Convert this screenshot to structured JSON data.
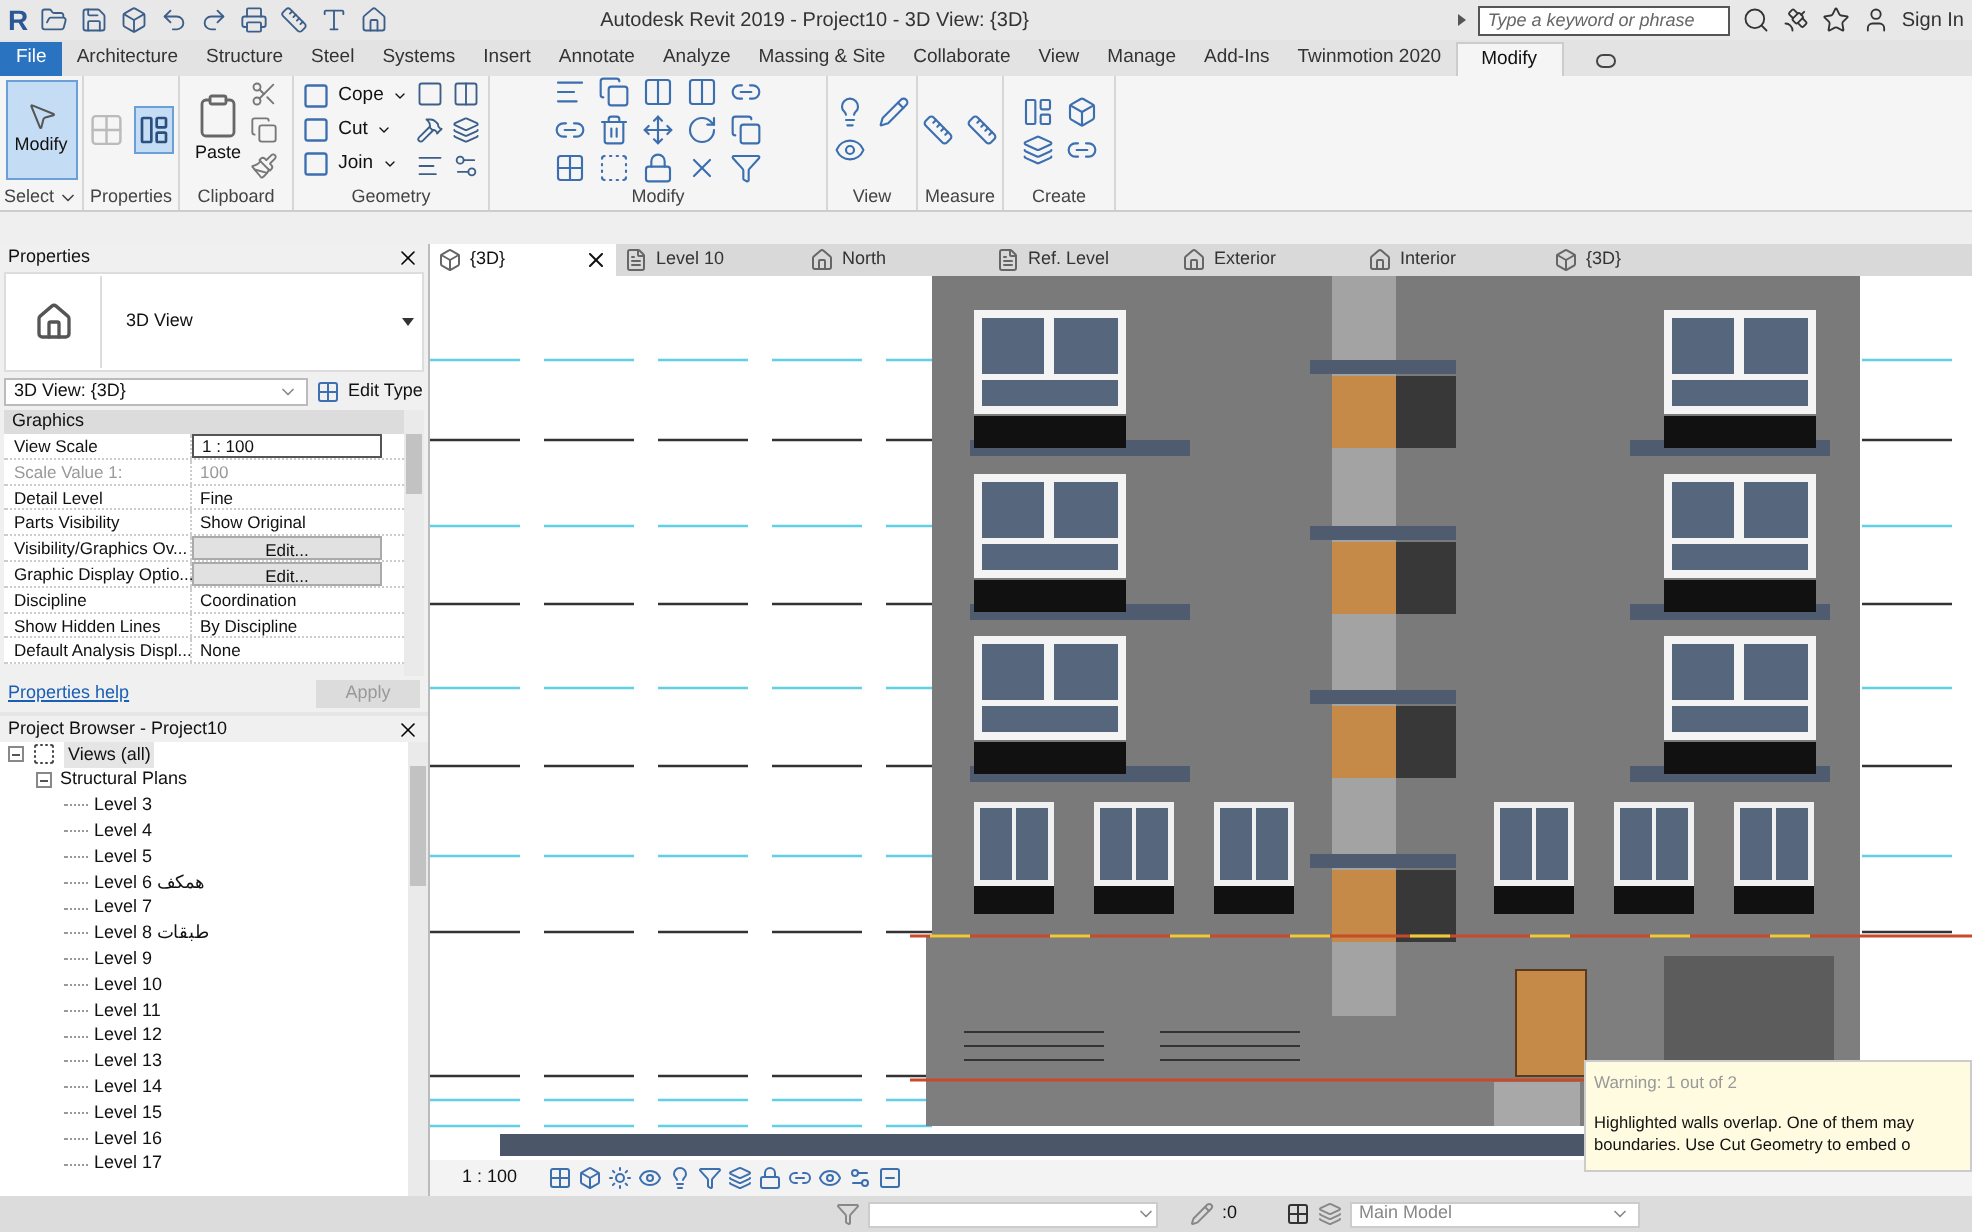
{
  "title_bar": {
    "logo": "R",
    "title": "Autodesk Revit 2019 - Project10 - 3D View: {3D}",
    "search": {
      "placeholder": "Type a keyword or phrase"
    },
    "sign_in": "Sign In"
  },
  "ribbon_tabs": [
    {
      "label": "File",
      "kind": "application",
      "selected": false
    },
    {
      "label": "Architecture",
      "kind": "tab",
      "selected": false
    },
    {
      "label": "Structure",
      "kind": "tab",
      "selected": false
    },
    {
      "label": "Steel",
      "kind": "tab",
      "selected": false
    },
    {
      "label": "Systems",
      "kind": "tab",
      "selected": false
    },
    {
      "label": "Insert",
      "kind": "tab",
      "selected": false
    },
    {
      "label": "Annotate",
      "kind": "tab",
      "selected": false
    },
    {
      "label": "Analyze",
      "kind": "tab",
      "selected": false
    },
    {
      "label": "Massing & Site",
      "kind": "tab",
      "selected": false
    },
    {
      "label": "Collaborate",
      "kind": "tab",
      "selected": false
    },
    {
      "label": "View",
      "kind": "tab",
      "selected": false
    },
    {
      "label": "Manage",
      "kind": "tab",
      "selected": false
    },
    {
      "label": "Add-Ins",
      "kind": "tab",
      "selected": false
    },
    {
      "label": "Twinmotion 2020",
      "kind": "tab",
      "selected": false
    },
    {
      "label": "Modify",
      "kind": "tab",
      "selected": true
    }
  ],
  "ribbon_panels": [
    {
      "label": "Select",
      "tools": [
        {
          "label": "Modify",
          "selected": true
        }
      ]
    },
    {
      "label": "Properties"
    },
    {
      "label": "Clipboard",
      "tools": [
        {
          "label": "Paste",
          "selected": false
        }
      ]
    },
    {
      "label": "Geometry",
      "tools": [
        {
          "label": "Cope",
          "selected": false
        },
        {
          "label": "Cut",
          "selected": false
        },
        {
          "label": "Join",
          "selected": false
        }
      ]
    },
    {
      "label": "Modify"
    },
    {
      "label": "View"
    },
    {
      "label": "Measure"
    },
    {
      "label": "Create"
    }
  ],
  "properties": {
    "title": "Properties",
    "type_name": "3D View",
    "type_selector": "3D View: {3D}",
    "edit_type": "Edit Type",
    "section": "Graphics",
    "rows": [
      {
        "name": "View Scale",
        "value": "1 : 100",
        "kind": "input",
        "disabled": false
      },
      {
        "name": "Scale Value    1:",
        "value": "100",
        "kind": "text",
        "disabled": true
      },
      {
        "name": "Detail Level",
        "value": "Fine",
        "kind": "text",
        "disabled": false
      },
      {
        "name": "Parts Visibility",
        "value": "Show Original",
        "kind": "text",
        "disabled": false
      },
      {
        "name": "Visibility/Graphics Ov...",
        "value": "Edit...",
        "kind": "button",
        "disabled": false
      },
      {
        "name": "Graphic Display Optio...",
        "value": "Edit...",
        "kind": "button",
        "disabled": false
      },
      {
        "name": "Discipline",
        "value": "Coordination",
        "kind": "text",
        "disabled": false
      },
      {
        "name": "Show Hidden Lines",
        "value": "By Discipline",
        "kind": "text",
        "disabled": false
      },
      {
        "name": "Default Analysis Displ...",
        "value": "None",
        "kind": "text",
        "disabled": false
      }
    ],
    "help_link": "Properties help",
    "apply": "Apply"
  },
  "project_browser": {
    "title": "Project Browser - Project10",
    "tree": [
      {
        "label": "Views (all)",
        "expanded": true,
        "selected": true,
        "children": [
          {
            "label": "Structural Plans",
            "expanded": true,
            "selected": false,
            "children": [
              {
                "label": "Level 3",
                "selected": false
              },
              {
                "label": "Level 4",
                "selected": false
              },
              {
                "label": "Level 5",
                "selected": false
              },
              {
                "label": "Level 6 همكف",
                "selected": false
              },
              {
                "label": "Level 7",
                "selected": false
              },
              {
                "label": "Level 8 طبقات",
                "selected": false
              },
              {
                "label": "Level 9",
                "selected": false
              },
              {
                "label": "Level 10",
                "selected": false
              },
              {
                "label": "Level 11",
                "selected": false
              },
              {
                "label": "Level 12",
                "selected": false
              },
              {
                "label": "Level 13",
                "selected": false
              },
              {
                "label": "Level 14",
                "selected": false
              },
              {
                "label": "Level 15",
                "selected": false
              },
              {
                "label": "Level 16",
                "selected": false
              },
              {
                "label": "Level 17",
                "selected": false
              }
            ]
          }
        ]
      }
    ]
  },
  "view_tabs": [
    {
      "label": "{3D}",
      "kind": "threed",
      "selected": true
    },
    {
      "label": "Level 10",
      "kind": "plan",
      "selected": false
    },
    {
      "label": "North",
      "kind": "elevation",
      "selected": false
    },
    {
      "label": "Ref. Level",
      "kind": "plan",
      "selected": false
    },
    {
      "label": "Exterior",
      "kind": "elevation",
      "selected": false
    },
    {
      "label": "Interior",
      "kind": "elevation",
      "selected": false
    },
    {
      "label": "{3D}",
      "kind": "threed",
      "selected": false
    }
  ],
  "view_control_bar": {
    "scale": "1 : 100"
  },
  "warning": {
    "title": "Warning: 1 out of 2",
    "lines": [
      "Highlighted walls overlap. One of them may",
      "boundaries. Use Cut Geometry to embed o"
    ]
  },
  "status_bar": {
    "selection_count": ":0",
    "model": "Main Model"
  }
}
